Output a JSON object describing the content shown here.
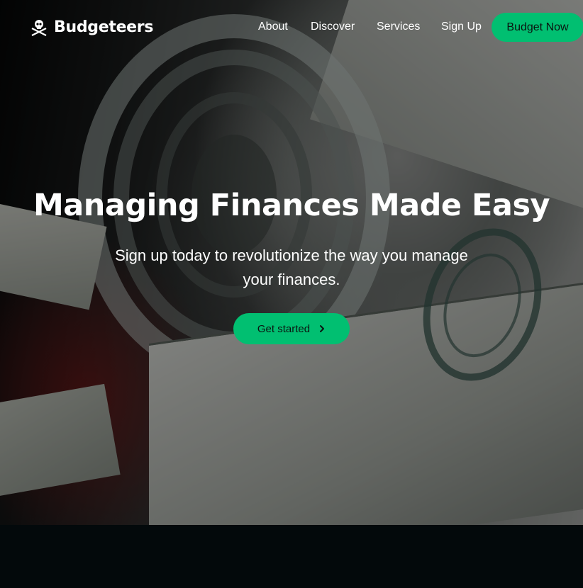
{
  "brand": {
    "name": "Budgeteers",
    "logo_icon": "skull-crossbones-icon"
  },
  "nav": {
    "links": [
      {
        "label": "About"
      },
      {
        "label": "Discover"
      },
      {
        "label": "Services"
      },
      {
        "label": "Sign Up"
      }
    ],
    "cta_label": "Budget Now"
  },
  "hero": {
    "title": "Managing Finances Made Easy",
    "subtitle": "Sign up today to revolutionize the way you manage your finances.",
    "button_label": "Get started",
    "button_icon": "chevron-right-icon"
  },
  "colors": {
    "accent": "#01bf71",
    "page_bg": "#040a0c",
    "text": "#ffffff"
  }
}
